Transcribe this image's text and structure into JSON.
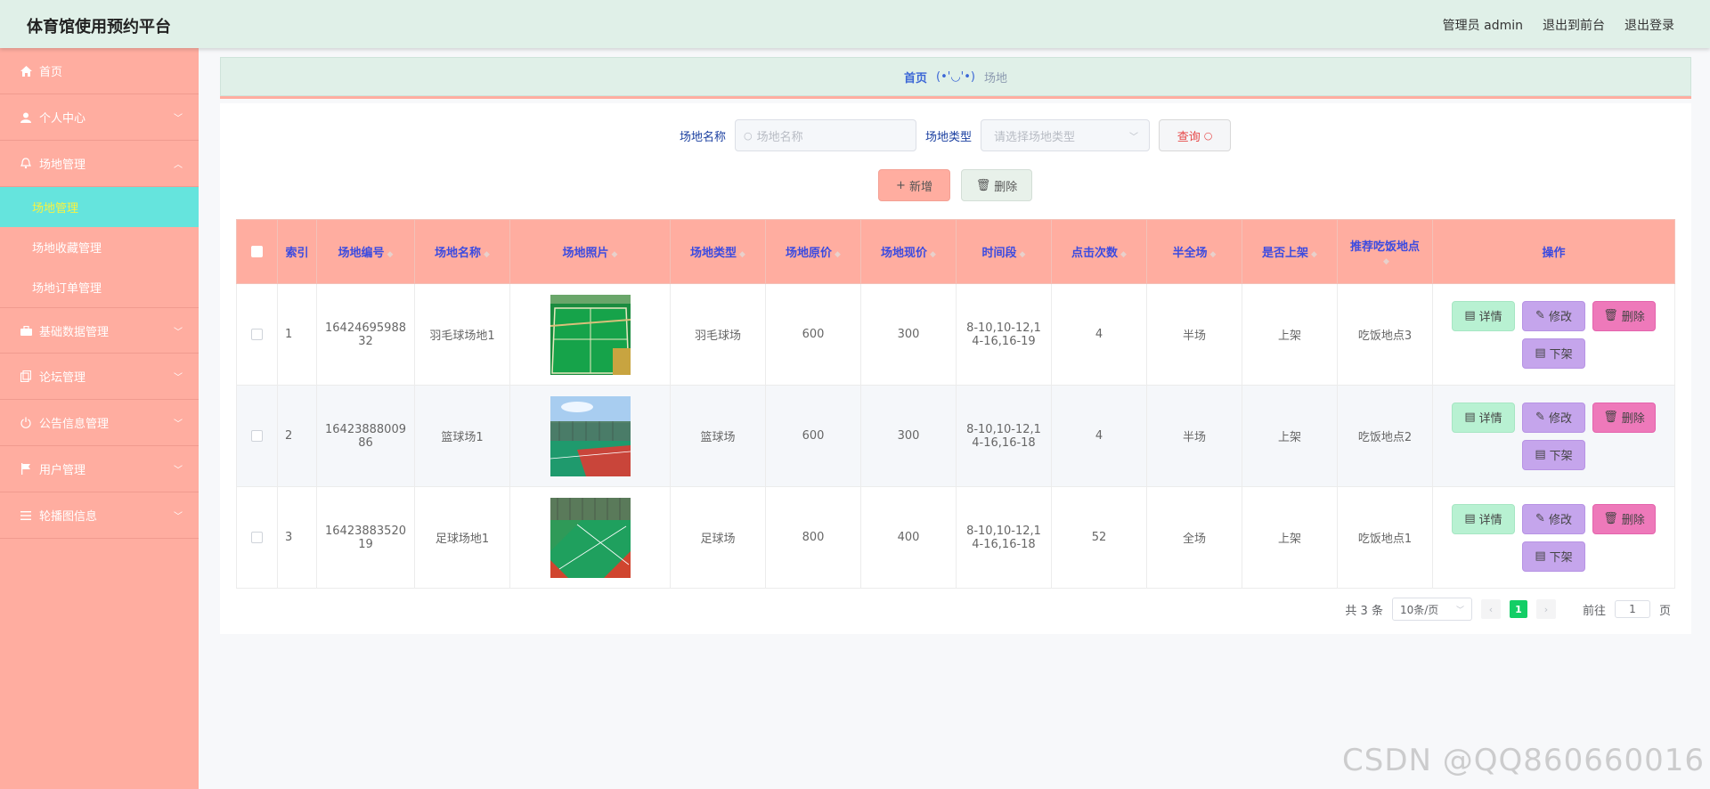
{
  "header": {
    "title": "体育馆使用预约平台",
    "user_label": "管理员 admin",
    "to_front": "退出到前台",
    "logout": "退出登录"
  },
  "sidebar": {
    "items": [
      {
        "label": "首页",
        "icon": "home-icon"
      },
      {
        "label": "个人中心",
        "icon": "user-icon"
      },
      {
        "label": "场地管理",
        "icon": "bell-icon",
        "expanded": true,
        "children": [
          {
            "label": "场地管理",
            "active": true
          },
          {
            "label": "场地收藏管理"
          },
          {
            "label": "场地订单管理"
          }
        ]
      },
      {
        "label": "基础数据管理",
        "icon": "briefcase-icon"
      },
      {
        "label": "论坛管理",
        "icon": "copy-icon"
      },
      {
        "label": "公告信息管理",
        "icon": "power-icon"
      },
      {
        "label": "用户管理",
        "icon": "flag-icon"
      },
      {
        "label": "轮播图信息",
        "icon": "menu-icon"
      }
    ]
  },
  "breadcrumb": {
    "home": "首页",
    "face": "(•'◡'•)",
    "current": "场地"
  },
  "search": {
    "name_label": "场地名称",
    "name_placeholder": "场地名称",
    "type_label": "场地类型",
    "type_placeholder": "请选择场地类型",
    "query_button": "查询"
  },
  "toolbar": {
    "add_label": "新增",
    "delete_label": "删除"
  },
  "table": {
    "columns": [
      "索引",
      "场地编号",
      "场地名称",
      "场地照片",
      "场地类型",
      "场地原价",
      "场地现价",
      "时间段",
      "点击次数",
      "半全场",
      "是否上架",
      "推荐吃饭地点",
      "操作"
    ],
    "rows": [
      {
        "index": "1",
        "code": "1642469598832",
        "name": "羽毛球场地1",
        "type": "羽毛球场",
        "orig_price": "600",
        "cur_price": "300",
        "time": "8-10,10-12,14-16,16-19",
        "clicks": "4",
        "half_full": "半场",
        "on_shelf": "上架",
        "food": "吃饭地点3",
        "photo": "badminton"
      },
      {
        "index": "2",
        "code": "1642388800986",
        "name": "篮球场1",
        "type": "篮球场",
        "orig_price": "600",
        "cur_price": "300",
        "time": "8-10,10-12,14-16,16-18",
        "clicks": "4",
        "half_full": "半场",
        "on_shelf": "上架",
        "food": "吃饭地点2",
        "photo": "basketball"
      },
      {
        "index": "3",
        "code": "1642388352019",
        "name": "足球场地1",
        "type": "足球场",
        "orig_price": "800",
        "cur_price": "400",
        "time": "8-10,10-12,14-16,16-18",
        "clicks": "52",
        "half_full": "全场",
        "on_shelf": "上架",
        "food": "吃饭地点1",
        "photo": "football"
      }
    ],
    "ops": {
      "detail": "详情",
      "edit": "修改",
      "remove": "删除",
      "off_shelf": "下架"
    }
  },
  "pagination": {
    "total": "共 3 条",
    "page_size": "10条/页",
    "current_page": "1",
    "goto_label": "前往",
    "goto_value": "1",
    "page_unit": "页"
  },
  "watermark": "CSDN @QQ860660016",
  "colors": {
    "header_bg": "#e0f0e8",
    "sidebar_bg": "#ffada0",
    "active_item_bg": "#65e4dd",
    "table_header_bg": "#ffada0",
    "detail_btn": "#b8f1d2",
    "edit_btn": "#c5a5ec",
    "delete_btn": "#ee79ba"
  }
}
